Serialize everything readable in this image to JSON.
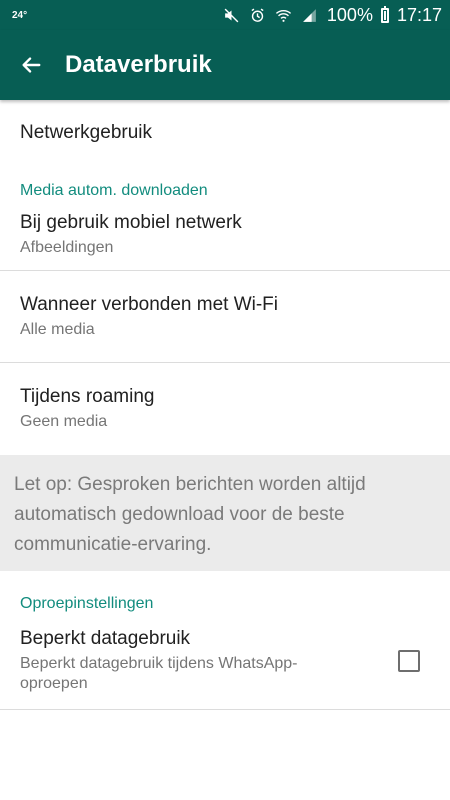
{
  "status_bar": {
    "temperature": "24°",
    "battery": "100%",
    "time": "17:17"
  },
  "header": {
    "title": "Dataverbruik"
  },
  "items": {
    "network_usage": {
      "title": "Netwerkgebruik"
    },
    "media_header": "Media autom. downloaden",
    "mobile": {
      "title": "Bij gebruik mobiel netwerk",
      "subtitle": "Afbeeldingen"
    },
    "wifi": {
      "title": "Wanneer verbonden met Wi-Fi",
      "subtitle": "Alle media"
    },
    "roaming": {
      "title": "Tijdens roaming",
      "subtitle": "Geen media"
    }
  },
  "note": "Let op: Gesproken berichten worden altijd automatisch gedownload voor de beste communicatie-ervaring.",
  "calls": {
    "header": "Oproepinstellingen",
    "low_data": {
      "title": "Beperkt datagebruik",
      "subtitle": "Beperkt datagebruik tijdens WhatsApp-oproepen",
      "checked": false
    }
  },
  "colors": {
    "primary": "#075e54",
    "accent": "#128c7e"
  }
}
